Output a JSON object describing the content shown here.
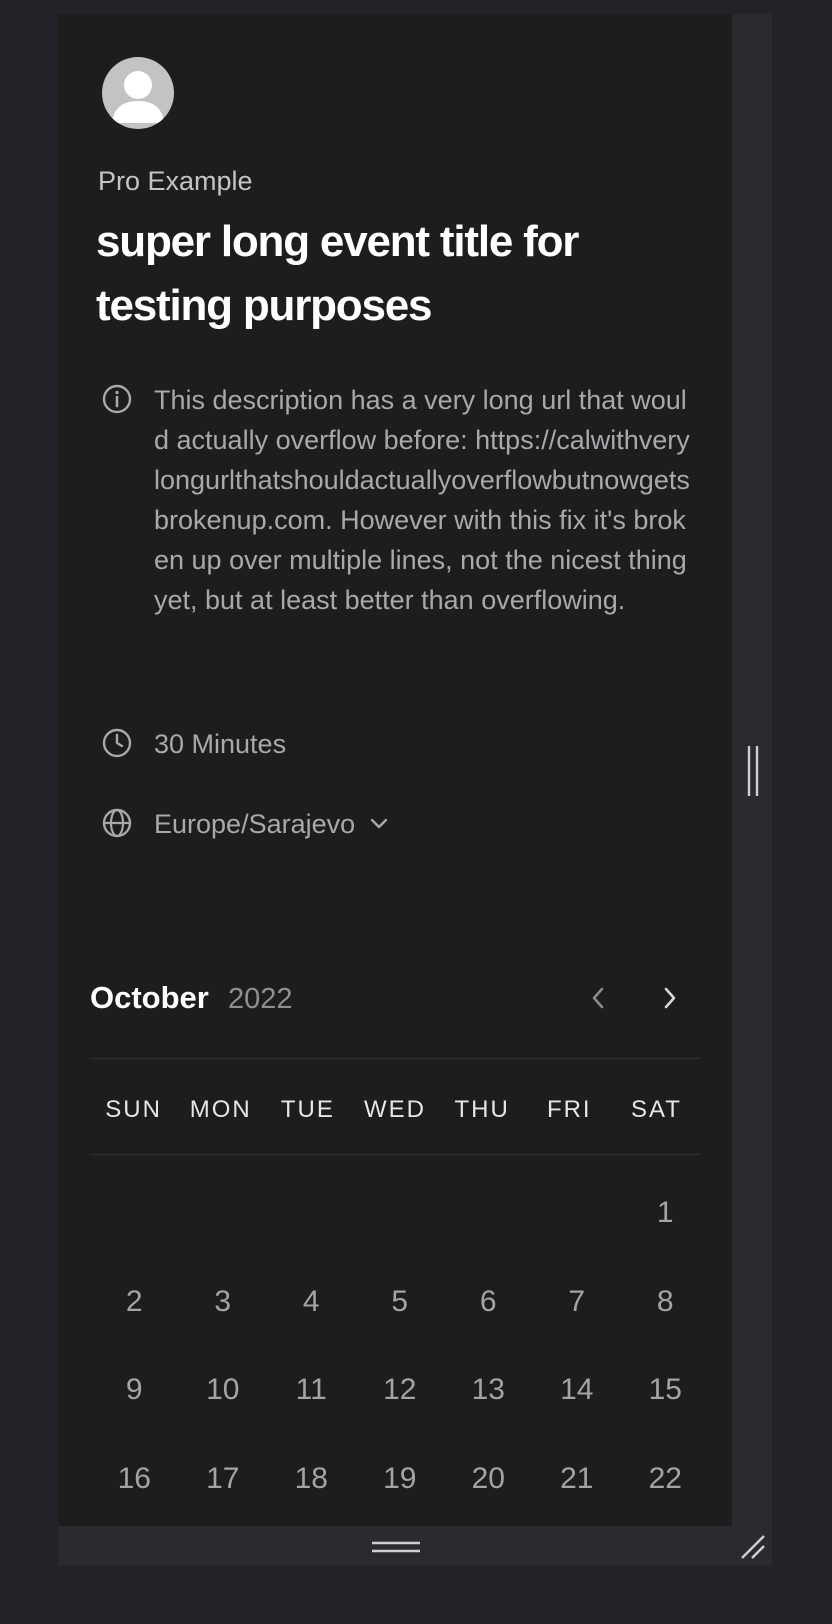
{
  "profile": {
    "org_name": "Pro Example"
  },
  "event": {
    "title": "super long event title for testing purposes",
    "description": "This description has a very long url that would actually overflow before: https://calwithverylongurlthatshouldactuallyoverflowbutnowgetsbrokenup.com. However with this fix it's broken up over multiple lines, not the nicest thing yet, but at least better than overflowing.",
    "duration": "30 Minutes",
    "timezone": "Europe/Sarajevo"
  },
  "calendar": {
    "month": "October",
    "year": "2022",
    "weekdays": [
      "SUN",
      "MON",
      "TUE",
      "WED",
      "THU",
      "FRI",
      "SAT"
    ],
    "leading_empty_days": 6,
    "days": [
      "1",
      "2",
      "3",
      "4",
      "5",
      "6",
      "7",
      "8",
      "9",
      "10",
      "11",
      "12",
      "13",
      "14",
      "15",
      "16",
      "17",
      "18",
      "19",
      "20",
      "21",
      "22"
    ]
  },
  "icons": {
    "description": "info-icon",
    "duration": "clock-icon",
    "timezone": "globe-icon",
    "timezone_dropdown": "chevron-down-icon",
    "prev_month": "chevron-left-icon",
    "next_month": "chevron-right-icon"
  },
  "colors": {
    "page_background": "#222328",
    "panel_background": "#1d1d1e",
    "title_text": "#ffffff",
    "muted_text": "#a8a8ad"
  }
}
